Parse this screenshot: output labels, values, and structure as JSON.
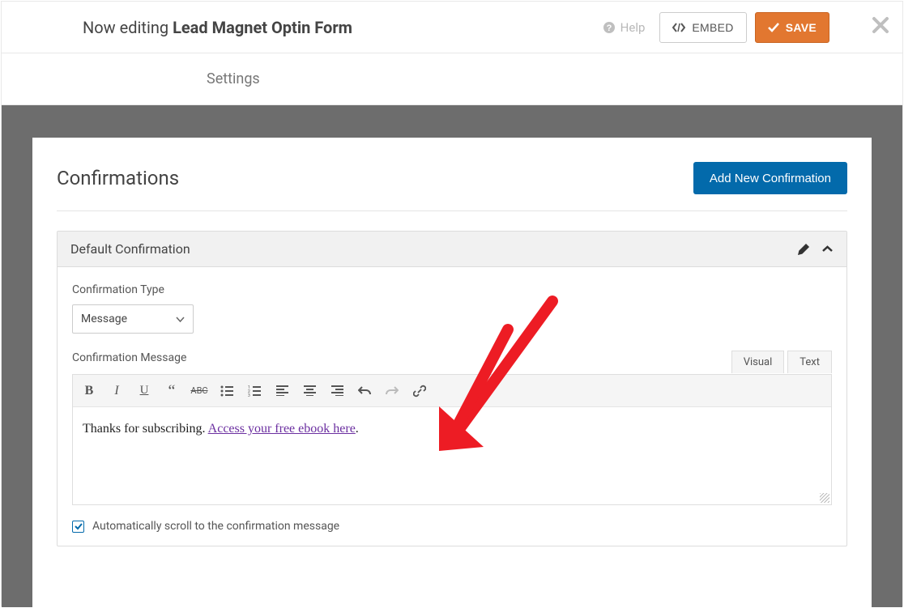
{
  "header": {
    "prefix": "Now editing",
    "form_name": "Lead Magnet Optin Form",
    "help_label": "Help",
    "embed_label": "EMBED",
    "save_label": "SAVE"
  },
  "tabs": {
    "settings": "Settings"
  },
  "panel": {
    "title": "Confirmations",
    "add_button": "Add New Confirmation"
  },
  "confirmation": {
    "name": "Default Confirmation",
    "type_label": "Confirmation Type",
    "type_value": "Message",
    "message_label": "Confirmation Message",
    "editor_tabs": {
      "visual": "Visual",
      "text": "Text"
    },
    "message_text_before": "Thanks for subscribing. ",
    "message_link_text": "Access your free ebook here",
    "message_text_after": ".",
    "auto_scroll_label": "Automatically scroll to the confirmation message",
    "auto_scroll_checked": true
  }
}
